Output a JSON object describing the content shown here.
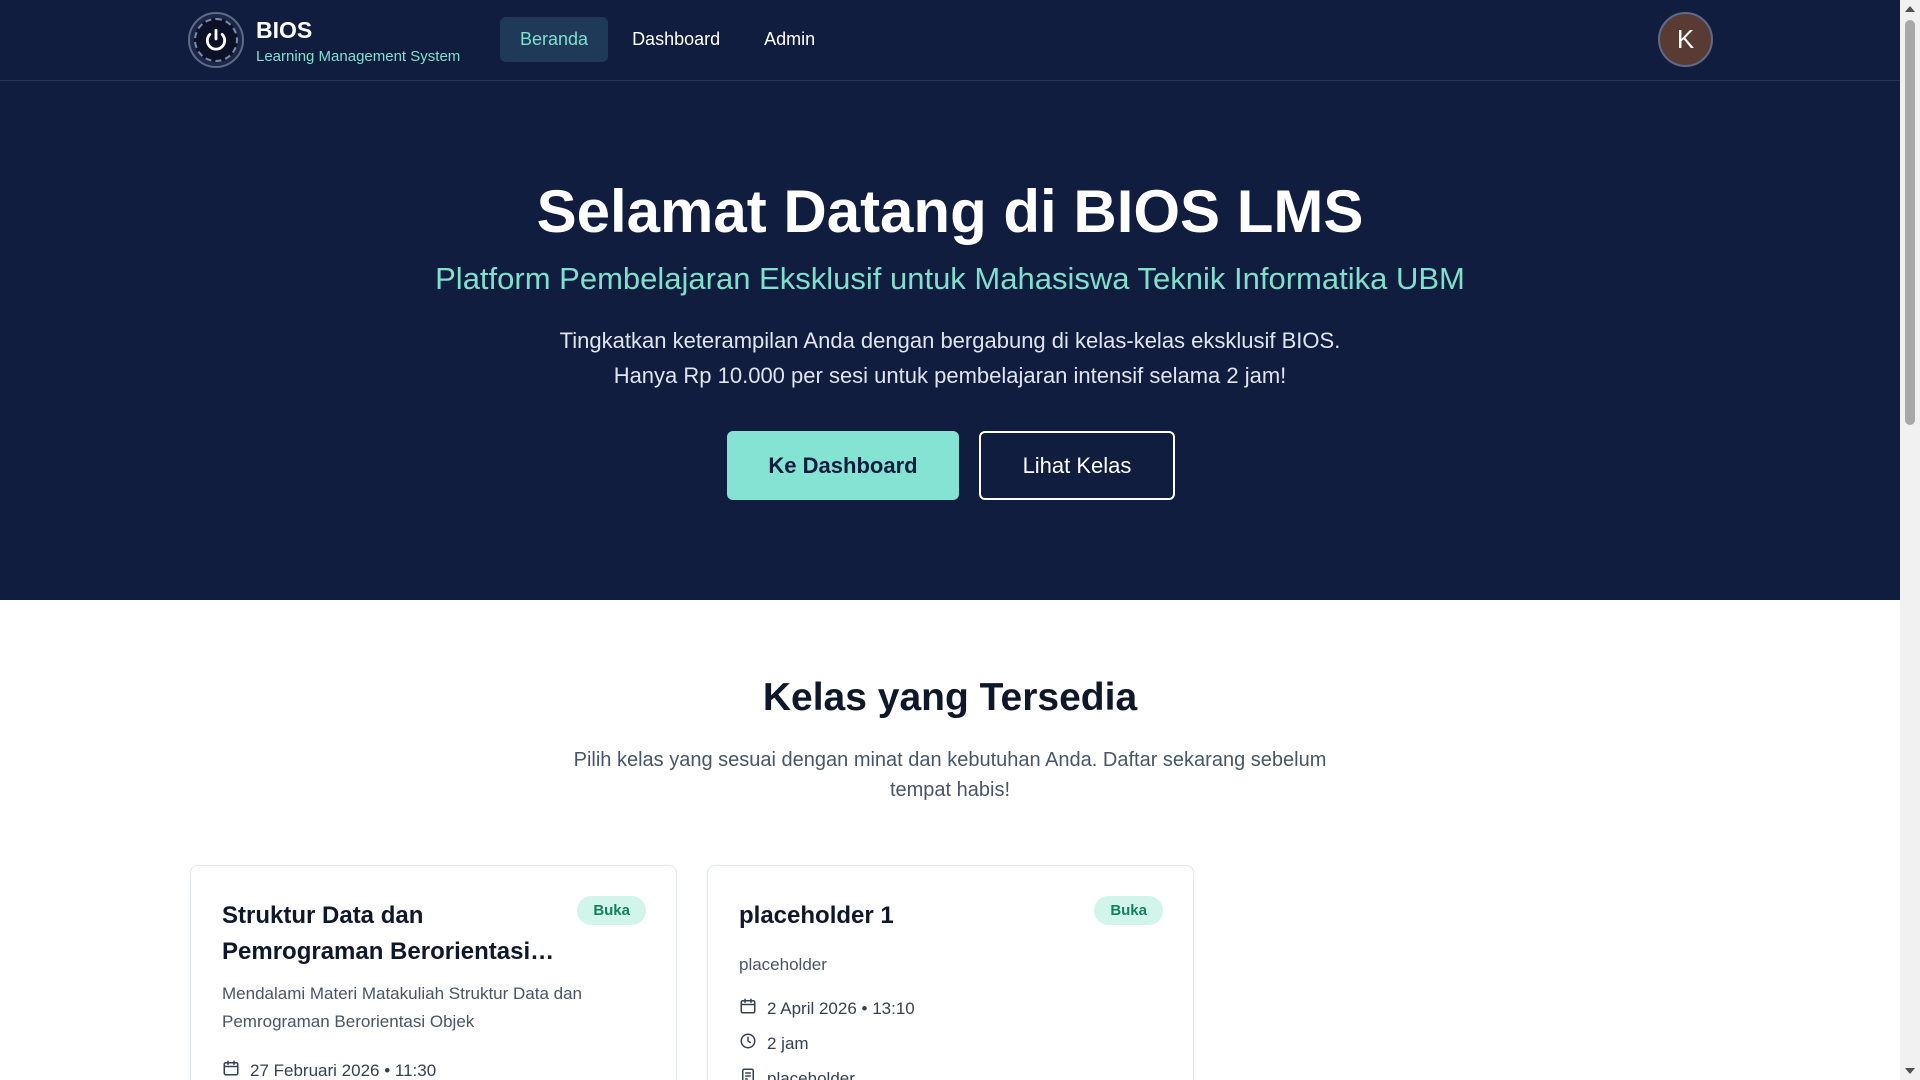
{
  "header": {
    "brand_name": "BIOS",
    "brand_tagline": "Learning Management System",
    "nav": [
      {
        "label": "Beranda"
      },
      {
        "label": "Dashboard"
      },
      {
        "label": "Admin"
      }
    ],
    "active_nav": "Beranda",
    "avatar_initial": "K"
  },
  "hero": {
    "title": "Selamat Datang di BIOS LMS",
    "subtitle": "Platform Pembelajaran Eksklusif untuk Mahasiswa Teknik Informatika UBM",
    "desc_line1": "Tingkatkan keterampilan Anda dengan bergabung di kelas-kelas eksklusif BIOS.",
    "desc_line2": "Hanya Rp 10.000 per sesi untuk pembelajaran intensif selama 2 jam!",
    "primary_button": "Ke Dashboard",
    "secondary_button": "Lihat Kelas"
  },
  "classes": {
    "title": "Kelas yang Tersedia",
    "desc": "Pilih kelas yang sesuai dengan minat dan kebutuhan Anda. Daftar sekarang sebelum tempat habis!",
    "cards": [
      {
        "title": "Struktur Data dan Pemrograman Berorientasi Objek",
        "badge": "Buka",
        "description": "Mendalami Materi Matakuliah Struktur Data dan Pemrograman Berorientasi Objek",
        "date": "27 Februari 2026 • 11:30"
      },
      {
        "title": "placeholder 1",
        "badge": "Buka",
        "description": "placeholder",
        "date": "2 April 2026 • 13:10",
        "duration": "2 jam",
        "location": "placeholder"
      }
    ]
  },
  "colors": {
    "navy": "#111d3f",
    "accent": "#7ee0cd",
    "badge_bg": "#d1f5ea",
    "badge_text": "#15805d"
  },
  "icons": [
    "power-icon",
    "calendar-icon",
    "clock-icon",
    "location-icon"
  ]
}
